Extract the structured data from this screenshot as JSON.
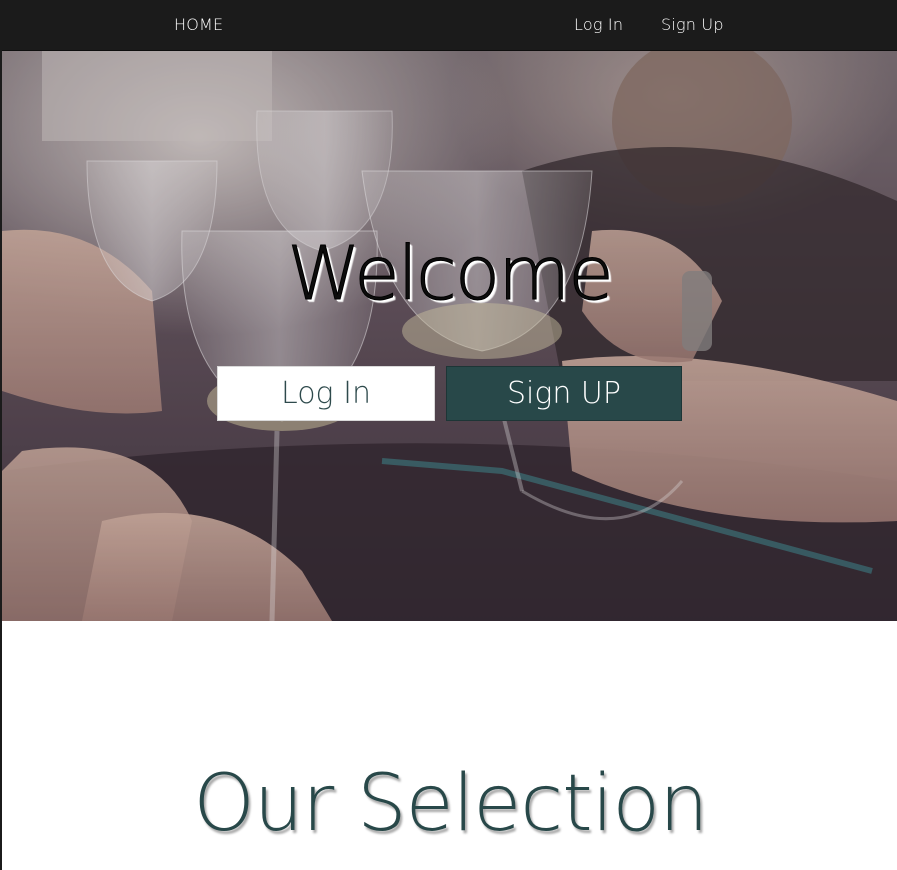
{
  "nav": {
    "home_label": "HOME",
    "login_label": "Log In",
    "signup_label": "Sign Up"
  },
  "hero": {
    "heading": "Welcome",
    "login_button": "Log In",
    "signup_button": "Sign UP",
    "background_image": "friends-toasting-wine-glasses-photo"
  },
  "selection": {
    "title": "Our Selection"
  },
  "colors": {
    "nav_bg": "#1b1b1b",
    "accent": "#284849",
    "page_bg": "#ffffff"
  }
}
